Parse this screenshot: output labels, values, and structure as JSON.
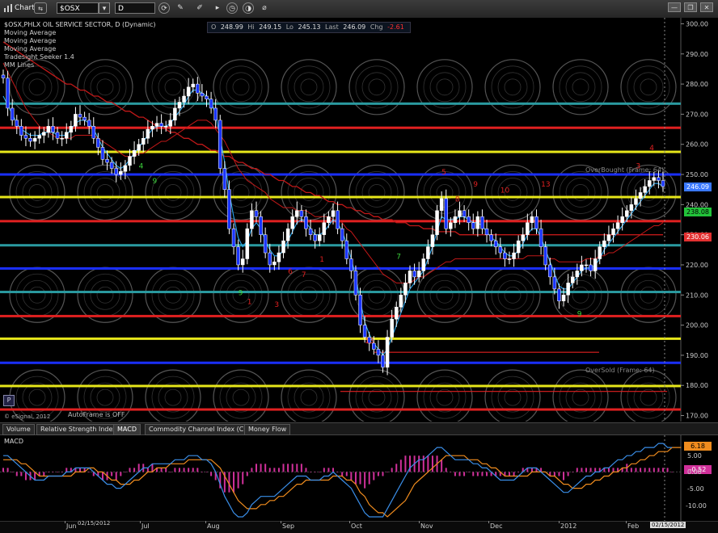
{
  "toolbar": {
    "window_title": "Chart",
    "symbol": "$OSX",
    "interval": "D",
    "icons": [
      "link-icon",
      "dropdown-icon",
      "refresh-icon",
      "pencil-icon",
      "brush-icon",
      "play-icon",
      "timer-icon",
      "eraser-icon",
      "minimize-icon",
      "restore-icon",
      "close-icon"
    ]
  },
  "ohlc": {
    "o_label": "O",
    "o": "248.99",
    "h_label": "Hi",
    "h": "249.15",
    "l_label": "Lo",
    "l": "245.13",
    "last_label": "Last",
    "last": "246.09",
    "chg_label": "Chg",
    "chg": "-2.61"
  },
  "legend": {
    "title": "$OSX,PHLX OIL SERVICE SECTOR, D (Dynamic)",
    "line1": "Moving Average",
    "line2": "Moving Average",
    "line3": "Moving Average",
    "line4": "Tradesight Seeker 1.4",
    "line5": "MM Lines"
  },
  "annotations": {
    "overbought": "OverBought (Frame: 64)",
    "oversold": "OverSold (Frame: 64)",
    "autoframe": "AutoFrame is OFF",
    "copyright": "© eSignal, 2012",
    "p_button": "P"
  },
  "price_tags": {
    "last": "246.09",
    "ma1": "238.08",
    "ma2": "230.06",
    "colors": {
      "last": "#3a78ff",
      "ma1": "#22c33a",
      "ma2": "#e23030"
    }
  },
  "tabs": [
    "Volume",
    "Relative Strength Index",
    "MACD",
    "Commodity Channel Index (CCI)",
    "Money Flow"
  ],
  "active_tab": "MACD",
  "macd_panel": {
    "title": "MACD",
    "tags": {
      "macd": "6.18",
      "hist": "-0.52"
    },
    "ticks": [
      "5.00",
      "0.00",
      "-5.00",
      "-10.00"
    ]
  },
  "xaxis": {
    "labels": [
      "Jun",
      "Jul",
      "Aug",
      "Sep",
      "Oct",
      "Nov",
      "Dec",
      "2012",
      "Feb"
    ],
    "date_box": "02/15/2012",
    "cursor_box": "02/15/2012"
  },
  "chart_data": {
    "type": "candlestick",
    "title": "$OSX,PHLX OIL SERVICE SECTOR, D (Dynamic)",
    "ylim": [
      168,
      302
    ],
    "yticks": [
      170,
      180,
      190,
      200,
      210,
      220,
      230,
      240,
      250,
      260,
      270,
      280,
      290,
      300
    ],
    "xlabels": [
      "Jun",
      "Jul",
      "Aug",
      "Sep",
      "Oct",
      "Nov",
      "Dec",
      "2012",
      "Feb"
    ],
    "mm_lines": [
      {
        "value": 273.5,
        "color": "#2a9aa0"
      },
      {
        "value": 265.5,
        "color": "#e02020"
      },
      {
        "value": 257.5,
        "color": "#e6e61a"
      },
      {
        "value": 250.0,
        "color": "#1a2fff"
      },
      {
        "value": 242.5,
        "color": "#e6e61a"
      },
      {
        "value": 234.5,
        "color": "#e02020"
      },
      {
        "value": 226.5,
        "color": "#2a9aa0"
      },
      {
        "value": 218.8,
        "color": "#1a2fff"
      },
      {
        "value": 211.0,
        "color": "#2a9aa0"
      },
      {
        "value": 203.0,
        "color": "#e02020"
      },
      {
        "value": 195.5,
        "color": "#e6e61a"
      },
      {
        "value": 187.5,
        "color": "#1a2fff"
      },
      {
        "value": 179.8,
        "color": "#e6e61a"
      },
      {
        "value": 172.0,
        "color": "#e02020"
      }
    ],
    "closes": [
      282,
      272,
      268,
      266,
      263,
      262,
      261,
      262,
      263,
      264,
      266,
      264,
      262,
      262,
      264,
      266,
      270,
      269,
      268,
      266,
      262,
      259,
      255,
      254,
      252,
      250,
      251,
      253,
      256,
      258,
      260,
      262,
      265,
      266,
      267,
      266,
      266,
      268,
      272,
      274,
      276,
      279,
      280,
      277,
      276,
      275,
      272,
      268,
      252,
      245,
      232,
      226,
      220,
      222,
      232,
      238,
      236,
      230,
      224,
      220,
      221,
      224,
      228,
      232,
      236,
      238,
      236,
      232,
      230,
      228,
      230,
      234,
      236,
      238,
      232,
      228,
      222,
      218,
      210,
      200,
      196,
      194,
      192,
      190,
      186,
      196,
      202,
      206,
      210,
      214,
      218,
      216,
      218,
      222,
      226,
      230,
      238,
      242,
      232,
      234,
      236,
      238,
      236,
      234,
      232,
      236,
      232,
      230,
      228,
      226,
      224,
      222,
      222,
      224,
      228,
      230,
      234,
      236,
      232,
      226,
      220,
      216,
      212,
      208,
      210,
      214,
      216,
      218,
      220,
      220,
      218,
      222,
      226,
      228,
      230,
      232,
      234,
      236,
      238,
      240,
      242,
      244,
      246,
      248,
      249,
      248,
      246
    ],
    "ma_fast": [
      276,
      273,
      270,
      267,
      265,
      264,
      263,
      263,
      263,
      264,
      264,
      264,
      263,
      263,
      263,
      265,
      267,
      268,
      268,
      267,
      265,
      262,
      259,
      257,
      255,
      253,
      252,
      253,
      255,
      257,
      259,
      261,
      263,
      265,
      266,
      266,
      266,
      267,
      269,
      271,
      273,
      276,
      278,
      278,
      277,
      276,
      274,
      270,
      262,
      254,
      244,
      236,
      229,
      226,
      228,
      232,
      234,
      232,
      228,
      225,
      223,
      223,
      225,
      228,
      231,
      234,
      235,
      234,
      232,
      230,
      230,
      231,
      233,
      235,
      234,
      231,
      227,
      222,
      216,
      208,
      201,
      197,
      194,
      192,
      190,
      192,
      196,
      200,
      204,
      208,
      212,
      214,
      216,
      218,
      222,
      226,
      231,
      236,
      235,
      235,
      235,
      236,
      236,
      235,
      234,
      234,
      233,
      231,
      229,
      228,
      226,
      224,
      223,
      223,
      225,
      227,
      230,
      232,
      232,
      229,
      225,
      221,
      217,
      213,
      212,
      212,
      214,
      216,
      218,
      219,
      219,
      220,
      222,
      225,
      227,
      229,
      231,
      233,
      235,
      237,
      239,
      241,
      243,
      245,
      247,
      247,
      246
    ],
    "ma_mid": [
      287,
      284,
      281,
      278,
      275,
      272,
      270,
      268,
      266,
      265,
      264,
      263,
      262,
      262,
      262,
      262,
      263,
      263,
      263,
      263,
      263,
      262,
      261,
      260,
      259,
      258,
      257,
      256,
      256,
      256,
      257,
      257,
      258,
      259,
      260,
      261,
      261,
      262,
      263,
      264,
      265,
      266,
      267,
      268,
      268,
      268,
      267,
      265,
      263,
      261,
      258,
      255,
      252,
      250,
      248,
      247,
      246,
      245,
      244,
      242,
      241,
      240,
      239,
      239,
      239,
      238,
      238,
      238,
      237,
      236,
      236,
      236,
      236,
      235,
      235,
      234,
      232,
      231,
      229,
      227,
      225,
      223,
      221,
      219,
      217,
      216,
      215,
      214,
      214,
      214,
      214,
      215,
      216,
      216,
      217,
      218,
      219,
      220,
      221,
      221,
      222,
      222,
      222,
      222,
      222,
      222,
      222,
      222,
      222,
      222,
      222,
      222,
      222,
      222,
      222,
      222,
      223,
      223,
      223,
      223,
      223,
      222,
      222,
      221,
      221,
      221,
      221,
      221,
      221,
      222,
      222,
      222,
      223,
      223,
      224,
      224,
      225,
      226,
      227,
      228,
      229,
      230,
      231,
      232,
      233,
      233,
      234
    ],
    "ma_slow": [
      294,
      293,
      292,
      291,
      290,
      289,
      288,
      287,
      286,
      285,
      284,
      283,
      282,
      281,
      280,
      280,
      279,
      278,
      278,
      277,
      276,
      276,
      275,
      274,
      274,
      273,
      272,
      271,
      271,
      270,
      269,
      269,
      268,
      267,
      266,
      266,
      265,
      264,
      264,
      263,
      262,
      262,
      261,
      260,
      260,
      259,
      258,
      258,
      257,
      256,
      256,
      255,
      254,
      254,
      253,
      252,
      252,
      251,
      250,
      250,
      249,
      248,
      248,
      247,
      246,
      246,
      245,
      244,
      244,
      243,
      243,
      242,
      241,
      241,
      240,
      240,
      239,
      239,
      238,
      238,
      237,
      237,
      236,
      236,
      235,
      235,
      235,
      234,
      234,
      234,
      233,
      233,
      233,
      232,
      232,
      232,
      231,
      231,
      231,
      231,
      231,
      230,
      230,
      230,
      230,
      230,
      230,
      230,
      230,
      230,
      230,
      230,
      230,
      230,
      230,
      230,
      230,
      230,
      230,
      230,
      230,
      230,
      230,
      230,
      230,
      230,
      230,
      230,
      230,
      230,
      230,
      230,
      230,
      230,
      230,
      230,
      230,
      230,
      230,
      230,
      230,
      230,
      230,
      230,
      230,
      230,
      230
    ],
    "tdst_lines": [
      {
        "from": 0.55,
        "to": 0.88,
        "value": 191,
        "color": "#e02020"
      },
      {
        "from": 0.5,
        "to": 0.98,
        "value": 178,
        "color": "#e02020"
      }
    ],
    "seq_labels": [
      {
        "i": 30,
        "v": 252,
        "t": "4",
        "c": "#3bd13b"
      },
      {
        "i": 33,
        "v": 247,
        "t": "9",
        "c": "#3bd13b"
      },
      {
        "i": 52,
        "v": 210,
        "t": "9",
        "c": "#3bd13b"
      },
      {
        "i": 54,
        "v": 207,
        "t": "1",
        "c": "#e02020"
      },
      {
        "i": 60,
        "v": 206,
        "t": "3",
        "c": "#e02020"
      },
      {
        "i": 63,
        "v": 217,
        "t": "6",
        "c": "#e02020"
      },
      {
        "i": 66,
        "v": 216,
        "t": "7",
        "c": "#e02020"
      },
      {
        "i": 70,
        "v": 221,
        "t": "1",
        "c": "#e02020"
      },
      {
        "i": 80,
        "v": 194,
        "t": "13",
        "c": "#e02020"
      },
      {
        "i": 87,
        "v": 222,
        "t": "7",
        "c": "#3bd13b"
      },
      {
        "i": 97,
        "v": 250,
        "t": "5",
        "c": "#e02020"
      },
      {
        "i": 100,
        "v": 241,
        "t": "8",
        "c": "#e02020"
      },
      {
        "i": 104,
        "v": 246,
        "t": "9",
        "c": "#e02020"
      },
      {
        "i": 110,
        "v": 244,
        "t": "10",
        "c": "#e02020"
      },
      {
        "i": 119,
        "v": 246,
        "t": "13",
        "c": "#e02020"
      },
      {
        "i": 127,
        "v": 203,
        "t": "9",
        "c": "#3bd13b"
      },
      {
        "i": 140,
        "v": 252,
        "t": "3",
        "c": "#e02020"
      },
      {
        "i": 143,
        "v": 258,
        "t": "4",
        "c": "#e02020"
      }
    ],
    "macd_series": [
      {
        "name": "MACD",
        "color": "#3a8ee8"
      },
      {
        "name": "Signal",
        "color": "#f08c1e"
      },
      {
        "name": "Histogram",
        "color": "#d0309a"
      }
    ],
    "macd_ylim": [
      -12,
      9
    ],
    "macd": [
      4,
      4,
      3,
      2,
      1,
      0,
      -1,
      -2,
      -2,
      -2,
      -1,
      -1,
      -1,
      -1,
      0,
      0,
      1,
      1,
      1,
      1,
      0,
      -1,
      -2,
      -3,
      -3,
      -4,
      -4,
      -3,
      -2,
      -1,
      0,
      1,
      1,
      2,
      2,
      2,
      2,
      2,
      3,
      3,
      3,
      4,
      4,
      4,
      3,
      3,
      2,
      0,
      -3,
      -6,
      -8,
      -10,
      -11,
      -11,
      -10,
      -8,
      -7,
      -6,
      -6,
      -6,
      -6,
      -5,
      -4,
      -3,
      -2,
      -1,
      -1,
      -1,
      -2,
      -2,
      -2,
      -1,
      -1,
      0,
      -1,
      -2,
      -3,
      -4,
      -6,
      -8,
      -10,
      -11,
      -11,
      -11,
      -11,
      -9,
      -7,
      -5,
      -3,
      -1,
      1,
      2,
      3,
      3,
      4,
      5,
      6,
      6,
      5,
      4,
      3,
      3,
      3,
      3,
      2,
      2,
      1,
      1,
      0,
      -1,
      -2,
      -2,
      -2,
      -2,
      -1,
      0,
      1,
      1,
      1,
      0,
      -1,
      -2,
      -3,
      -4,
      -5,
      -5,
      -4,
      -3,
      -2,
      -1,
      -1,
      0,
      0,
      1,
      1,
      2,
      3,
      3,
      4,
      4,
      5,
      5,
      6,
      6,
      6,
      7,
      7,
      6,
      6
    ],
    "signal": [
      3,
      3,
      3,
      3,
      2,
      2,
      1,
      0,
      -1,
      -1,
      -1,
      -1,
      -1,
      -1,
      -1,
      -1,
      0,
      0,
      0,
      1,
      1,
      0,
      0,
      -1,
      -2,
      -2,
      -3,
      -3,
      -3,
      -2,
      -2,
      -1,
      0,
      0,
      1,
      1,
      1,
      2,
      2,
      2,
      2,
      3,
      3,
      3,
      3,
      3,
      3,
      2,
      1,
      -1,
      -3,
      -5,
      -7,
      -8,
      -9,
      -9,
      -9,
      -8,
      -8,
      -7,
      -7,
      -6,
      -6,
      -5,
      -4,
      -3,
      -3,
      -2,
      -2,
      -2,
      -2,
      -2,
      -2,
      -1,
      -1,
      -1,
      -2,
      -2,
      -3,
      -5,
      -6,
      -8,
      -9,
      -10,
      -10,
      -11,
      -10,
      -9,
      -8,
      -7,
      -5,
      -3,
      -2,
      -1,
      0,
      1,
      2,
      3,
      4,
      4,
      4,
      4,
      4,
      3,
      3,
      3,
      2,
      2,
      1,
      1,
      0,
      -1,
      -1,
      -1,
      -1,
      -1,
      -1,
      0,
      0,
      0,
      0,
      -1,
      -1,
      -2,
      -3,
      -3,
      -4,
      -4,
      -4,
      -3,
      -3,
      -2,
      -2,
      -1,
      -1,
      0,
      0,
      1,
      1,
      2,
      2,
      3,
      3,
      4,
      4,
      5,
      5,
      5,
      6,
      6,
      6
    ],
    "hist": [
      1,
      1,
      0,
      -1,
      -1,
      -2,
      -2,
      -2,
      -1,
      -1,
      0,
      0,
      0,
      0,
      1,
      1,
      1,
      1,
      1,
      0,
      -1,
      -1,
      -2,
      -2,
      -1,
      -2,
      -1,
      0,
      1,
      1,
      2,
      2,
      1,
      2,
      1,
      1,
      1,
      0,
      1,
      1,
      1,
      1,
      1,
      1,
      0,
      0,
      -1,
      -2,
      -4,
      -5,
      -5,
      -5,
      -4,
      -3,
      -1,
      1,
      2,
      2,
      2,
      1,
      1,
      1,
      2,
      2,
      2,
      2,
      2,
      1,
      0,
      0,
      0,
      1,
      1,
      1,
      0,
      -1,
      -1,
      -2,
      -3,
      -3,
      -4,
      -3,
      -2,
      -1,
      -1,
      0,
      1,
      2,
      3,
      4,
      4,
      4,
      4,
      4,
      4,
      4,
      4,
      3,
      1,
      0,
      -1,
      -1,
      -1,
      0,
      -1,
      -1,
      -1,
      -1,
      -1,
      -1,
      -1,
      -1,
      -1,
      -1,
      0,
      1,
      1,
      1,
      1,
      1,
      0,
      -1,
      -1,
      -1,
      -2,
      -1,
      0,
      1,
      1,
      1,
      1,
      1,
      1,
      1,
      1,
      1,
      1,
      1,
      2,
      1,
      1,
      1,
      1,
      1,
      1,
      1,
      1,
      1,
      0
    ]
  }
}
